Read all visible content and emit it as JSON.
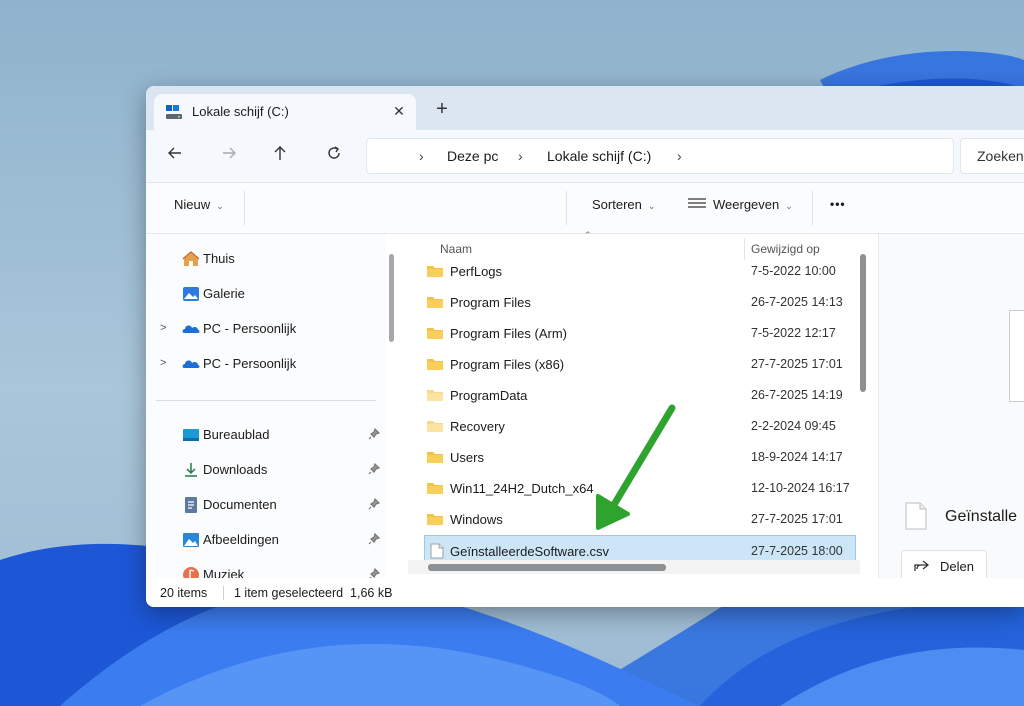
{
  "window": {
    "tab_title": "Lokale schijf (C:)",
    "new_tab": "+",
    "tab_close": "✕"
  },
  "address": {
    "crumbs": [
      "Deze pc",
      "Lokale schijf (C:)"
    ],
    "search_placeholder": "Zoeken"
  },
  "toolbar": {
    "new_label": "Nieuw",
    "sort_label": "Sorteren",
    "view_label": "Weergeven",
    "more_label": "•••"
  },
  "sidebar": {
    "items": [
      {
        "label": "Thuis",
        "icon": "home-icon"
      },
      {
        "label": "Galerie",
        "icon": "gallery-icon"
      },
      {
        "label": "PC - Persoonlijk",
        "icon": "onedrive-cloud-icon"
      },
      {
        "label": "PC - Persoonlijk",
        "icon": "onedrive-cloud-icon"
      },
      {
        "label": "Bureaublad",
        "icon": "desktop-icon"
      },
      {
        "label": "Downloads",
        "icon": "download-icon"
      },
      {
        "label": "Documenten",
        "icon": "documents-icon"
      },
      {
        "label": "Afbeeldingen",
        "icon": "pictures-icon"
      },
      {
        "label": "Muziek",
        "icon": "music-icon"
      }
    ]
  },
  "files": {
    "columns": {
      "name": "Naam",
      "modified": "Gewijzigd op"
    },
    "rows": [
      {
        "name": "PerfLogs",
        "modified": "7-5-2022 10:00",
        "type": "folder"
      },
      {
        "name": "Program Files",
        "modified": "26-7-2025 14:13",
        "type": "folder"
      },
      {
        "name": "Program Files (Arm)",
        "modified": "7-5-2022 12:17",
        "type": "folder"
      },
      {
        "name": "Program Files (x86)",
        "modified": "27-7-2025 17:01",
        "type": "folder"
      },
      {
        "name": "ProgramData",
        "modified": "26-7-2025 14:19",
        "type": "folder-light"
      },
      {
        "name": "Recovery",
        "modified": "2-2-2024 09:45",
        "type": "folder-light"
      },
      {
        "name": "Users",
        "modified": "18-9-2024 14:17",
        "type": "folder"
      },
      {
        "name": "Win11_24H2_Dutch_x64",
        "modified": "12-10-2024 16:17",
        "type": "folder"
      },
      {
        "name": "Windows",
        "modified": "27-7-2025 17:01",
        "type": "folder"
      },
      {
        "name": "GeïnstalleerdeSoftware.csv",
        "modified": "27-7-2025 18:00",
        "type": "file",
        "selected": true
      }
    ]
  },
  "details": {
    "title": "Geïnstalle",
    "share_label": "Delen"
  },
  "status": {
    "item_count": "20 items",
    "selection": "1 item geselecteerd  1,66 kB"
  },
  "colors": {
    "accent": "#0067c0",
    "selection": "#cde6f7",
    "arrow": "#2ea32e",
    "folder": "#f4c246"
  }
}
